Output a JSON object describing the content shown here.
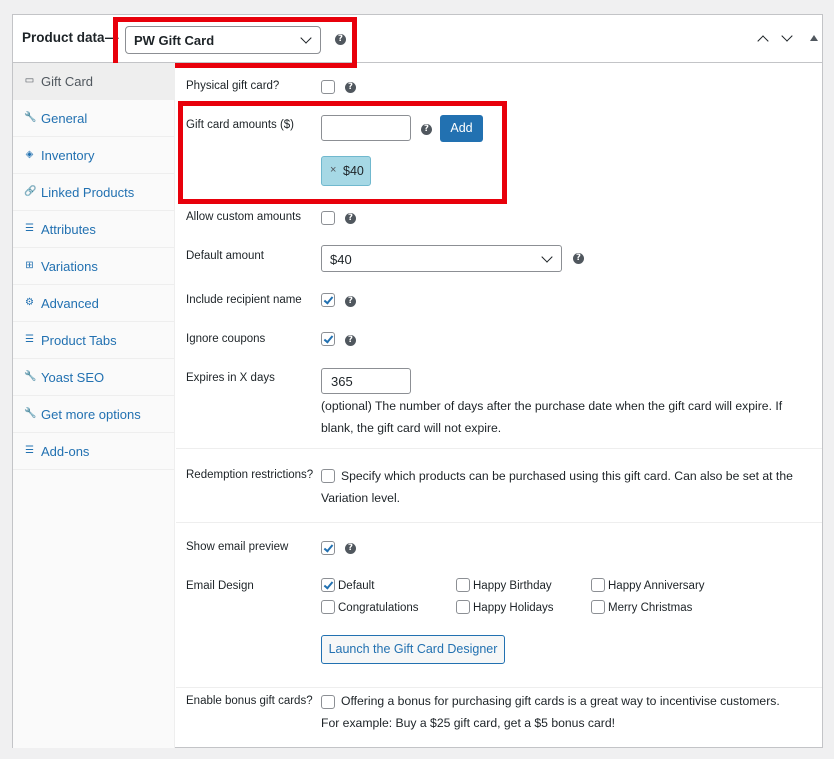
{
  "header": {
    "title": "Product data",
    "dash": "—",
    "product_type": "PW Gift Card",
    "help": "?"
  },
  "tabs": [
    {
      "label": "Gift Card",
      "icon": "gift-card-icon",
      "glyph": "▭"
    },
    {
      "label": "General",
      "icon": "wrench-icon",
      "glyph": "🔧"
    },
    {
      "label": "Inventory",
      "icon": "tag-icon",
      "glyph": "◈"
    },
    {
      "label": "Linked Products",
      "icon": "link-icon",
      "glyph": "🔗"
    },
    {
      "label": "Attributes",
      "icon": "list-icon",
      "glyph": "☰"
    },
    {
      "label": "Variations",
      "icon": "grid-icon",
      "glyph": "⊞"
    },
    {
      "label": "Advanced",
      "icon": "gear-icon",
      "glyph": "⚙"
    },
    {
      "label": "Product Tabs",
      "icon": "tabs-icon",
      "glyph": "☰"
    },
    {
      "label": "Yoast SEO",
      "icon": "wrench-icon",
      "glyph": "🔧"
    },
    {
      "label": "Get more options",
      "icon": "wrench-icon",
      "glyph": "🔧"
    },
    {
      "label": "Add-ons",
      "icon": "list-icon",
      "glyph": "☰"
    }
  ],
  "fields": {
    "physical": {
      "label": "Physical gift card?",
      "checked": false
    },
    "amounts": {
      "label": "Gift card amounts ($)",
      "value": "",
      "add_button": "Add",
      "chip_remove": "×",
      "chip": "$40"
    },
    "custom_amounts": {
      "label": "Allow custom amounts",
      "checked": false
    },
    "default_amount": {
      "label": "Default amount",
      "value": "$40"
    },
    "recipient": {
      "label": "Include recipient name",
      "checked": true
    },
    "coupons": {
      "label": "Ignore coupons",
      "checked": true
    },
    "expires": {
      "label": "Expires in X days",
      "value": "365",
      "desc_1": "(optional) The number of days after the purchase date when the gift card will expire. If",
      "desc_2": "blank, the gift card will not expire."
    },
    "redemption": {
      "label": "Redemption restrictions?",
      "desc_1": "Specify which products can be purchased using this gift card. Can also be set at the",
      "desc_2": "Variation level.",
      "checked": false
    },
    "email_preview": {
      "label": "Show email preview",
      "checked": true
    },
    "email_design": {
      "label": "Email Design",
      "options": [
        {
          "label": "Default",
          "checked": true
        },
        {
          "label": "Happy Birthday",
          "checked": false
        },
        {
          "label": "Happy Anniversary",
          "checked": false
        },
        {
          "label": "Congratulations",
          "checked": false
        },
        {
          "label": "Happy Holidays",
          "checked": false
        },
        {
          "label": "Merry Christmas",
          "checked": false
        }
      ],
      "designer_button": "Launch the Gift Card Designer"
    },
    "bonus": {
      "label": "Enable bonus gift cards?",
      "desc_1": "Offering a bonus for purchasing gift cards is a great way to incentivise customers.",
      "desc_2": "For example: Buy a $25 gift card, get a $5 bonus card!",
      "checked": false
    }
  },
  "colors": {
    "highlight": "#e8000b",
    "accent": "#2271b1",
    "chip": "#a6d8e5"
  }
}
